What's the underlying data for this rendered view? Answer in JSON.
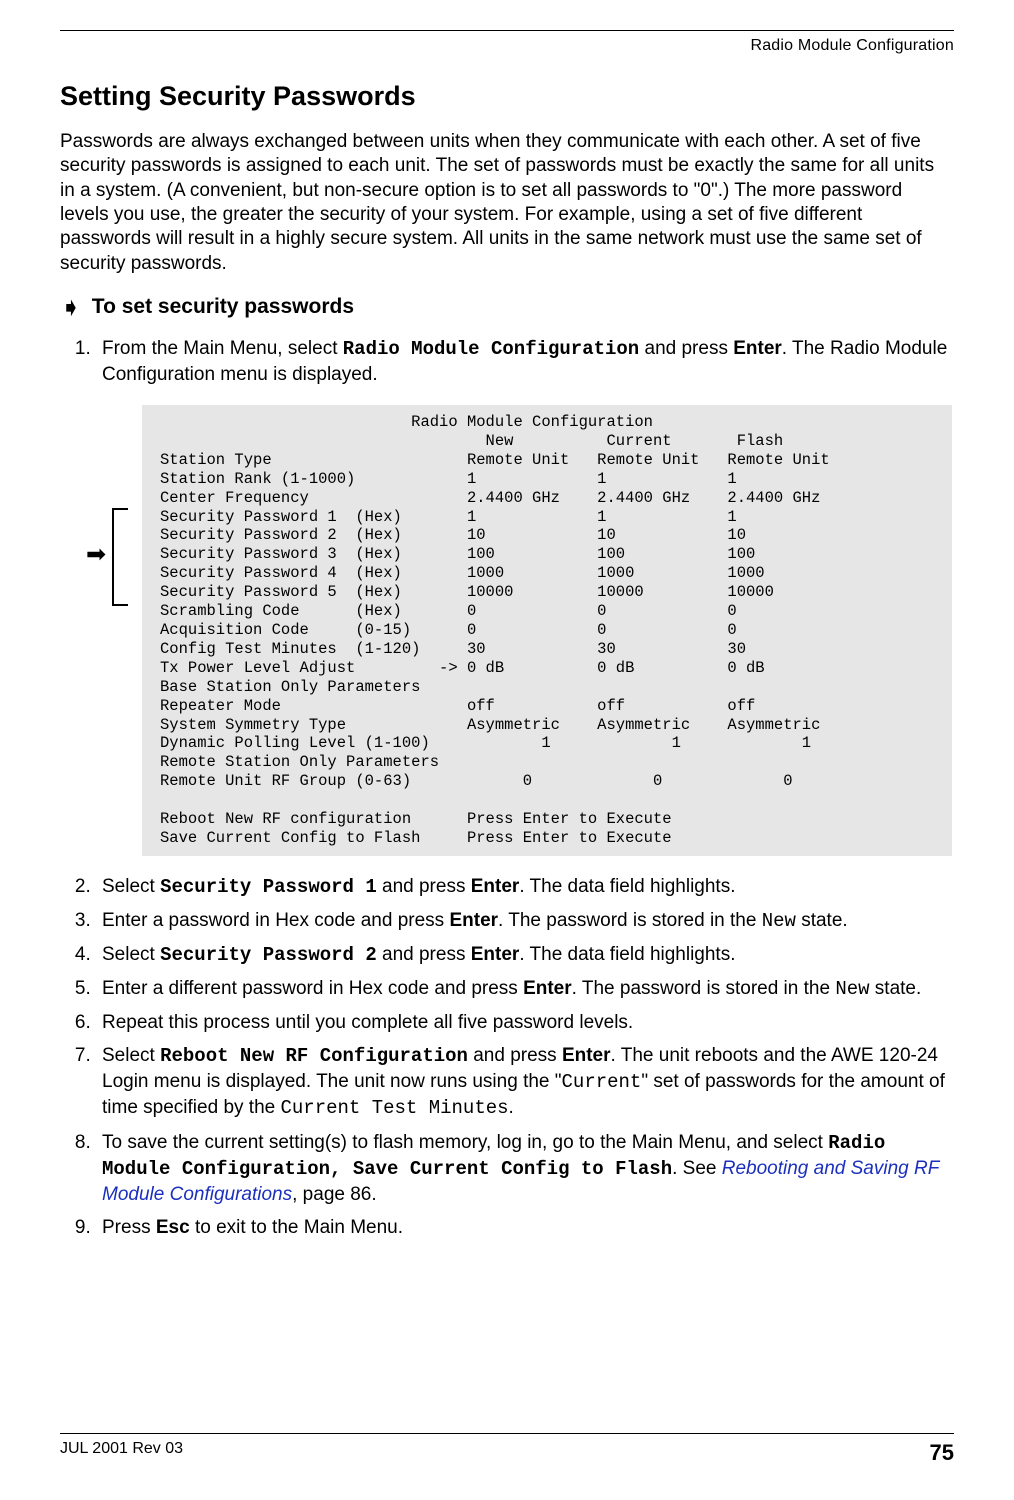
{
  "running_head": "Radio Module Configuration",
  "section_title": "Setting Security Passwords",
  "intro_paragraph": "Passwords are always exchanged between units when they communicate with each other. A set of five security passwords is assigned to each unit. The set of passwords must be exactly the same for all units in a system. (A convenient, but non-secure option is to set all passwords to \"0\".) The more password levels you use, the greater the security of your system. For example, using a set of five different passwords will result in a highly secure system. All units in the same network must use the same set of security passwords.",
  "procedure_heading": "To set security passwords",
  "steps": {
    "s1_pre": "From the Main Menu, select ",
    "s1_cmd": "Radio Module Configuration",
    "s1_mid": " and press ",
    "s1_key": "Enter",
    "s1_post": ". The Radio Module Configuration menu is displayed.",
    "s2_pre": "Select ",
    "s2_cmd": "Security Password 1",
    "s2_mid": " and press ",
    "s2_key": "Enter",
    "s2_post": ". The data field highlights.",
    "s3_pre": "Enter a password in Hex code and press ",
    "s3_key": "Enter",
    "s3_mid": ". The password is stored in the ",
    "s3_mono": "New",
    "s3_post": " state.",
    "s4_pre": "Select ",
    "s4_cmd": "Security Password 2",
    "s4_mid": " and press ",
    "s4_key": "Enter",
    "s4_post": ". The data field highlights.",
    "s5_pre": "Enter a different password in Hex code and press ",
    "s5_key": "Enter",
    "s5_mid": ". The password is stored in the ",
    "s5_mono": "New",
    "s5_post": " state.",
    "s6": "Repeat this process until you complete all five password levels.",
    "s7_pre": "Select ",
    "s7_cmd": "Reboot New RF Configuration",
    "s7_mid": " and press ",
    "s7_key": "Enter",
    "s7_post1": ". The unit reboots and the AWE 120-24 Login menu is displayed. The unit now runs using the \"",
    "s7_mono1": "Current",
    "s7_post2": "\" set of passwords for the amount of time specified by the ",
    "s7_mono2": "Current Test Minutes",
    "s7_post3": ".",
    "s8_pre": "To save the current setting(s) to flash memory, log in, go to the Main Menu, and select ",
    "s8_cmd": "Radio Module Configuration, Save Current Config to Flash",
    "s8_mid": ". See ",
    "s8_xref": "Rebooting and Saving RF Module Configurations",
    "s8_post": ", page 86.",
    "s9_pre": "Press ",
    "s9_key": "Esc",
    "s9_post": " to exit to the Main Menu."
  },
  "terminal": {
    "title": "Radio Module Configuration",
    "col_new": "New",
    "col_current": "Current",
    "col_flash": "Flash",
    "rows": [
      {
        "label": "Station Type",
        "opt": "",
        "new": "Remote Unit",
        "cur": "Remote Unit",
        "flash": "Remote Unit"
      },
      {
        "label": "Station Rank (1-1000)",
        "opt": "",
        "new": "1",
        "cur": "1",
        "flash": "1"
      },
      {
        "label": "Center Frequency",
        "opt": "",
        "new": "2.4400 GHz",
        "cur": "2.4400 GHz",
        "flash": "2.4400 GHz"
      },
      {
        "label": "Security Password 1",
        "opt": "(Hex)",
        "new": "1",
        "cur": "1",
        "flash": "1"
      },
      {
        "label": "Security Password 2",
        "opt": "(Hex)",
        "new": "10",
        "cur": "10",
        "flash": "10"
      },
      {
        "label": "Security Password 3",
        "opt": "(Hex)",
        "new": "100",
        "cur": "100",
        "flash": "100"
      },
      {
        "label": "Security Password 4",
        "opt": "(Hex)",
        "new": "1000",
        "cur": "1000",
        "flash": "1000"
      },
      {
        "label": "Security Password 5",
        "opt": "(Hex)",
        "new": "10000",
        "cur": "10000",
        "flash": "10000"
      },
      {
        "label": "Scrambling Code",
        "opt": "(Hex)",
        "new": "0",
        "cur": "0",
        "flash": "0"
      },
      {
        "label": "Acquisition Code",
        "opt": "(0-15)",
        "new": "0",
        "cur": "0",
        "flash": "0"
      },
      {
        "label": "Config Test Minutes",
        "opt": "(1-120)",
        "new": "30",
        "cur": "30",
        "flash": "30"
      },
      {
        "label": "Tx Power Level Adjust",
        "opt": "->",
        "new": "0 dB",
        "cur": "0 dB",
        "flash": "0 dB"
      },
      {
        "label": "Base Station Only Parameters",
        "opt": "",
        "new": "",
        "cur": "",
        "flash": ""
      },
      {
        "label": "Repeater Mode",
        "opt": "",
        "new": "off",
        "cur": "off",
        "flash": "off"
      },
      {
        "label": "System Symmetry Type",
        "opt": "",
        "new": "Asymmetric",
        "cur": "Asymmetric",
        "flash": "Asymmetric"
      },
      {
        "label": "Dynamic Polling Level (1-100)",
        "opt": "",
        "new": "1",
        "cur": "1",
        "flash": "1"
      },
      {
        "label": "Remote Station Only Parameters",
        "opt": "",
        "new": "",
        "cur": "",
        "flash": ""
      },
      {
        "label": "Remote Unit RF Group (0-63)",
        "opt": "",
        "new": "0",
        "cur": "0",
        "flash": "0"
      }
    ],
    "reboot_label": "Reboot New RF configuration",
    "reboot_action": "Press Enter to Execute",
    "save_label": "Save Current Config to Flash",
    "save_action": "Press Enter to Execute"
  },
  "footer": {
    "left": "JUL 2001 Rev 03",
    "page": "75"
  }
}
